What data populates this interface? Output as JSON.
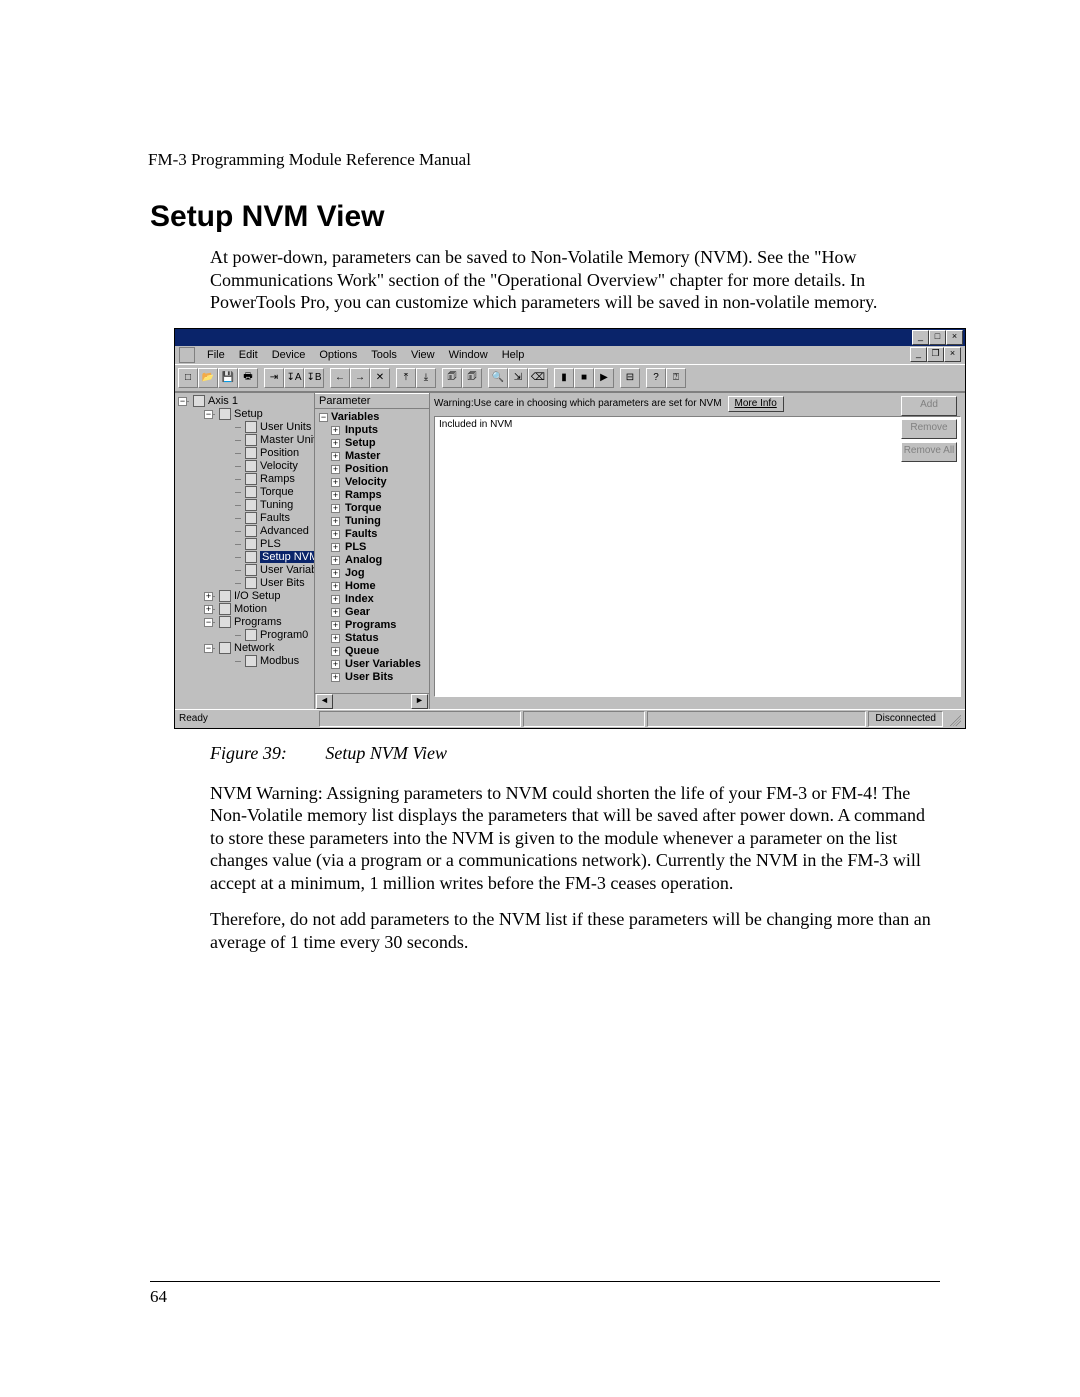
{
  "doc": {
    "header": "FM-3 Programming Module Reference Manual",
    "title": "Setup NVM View",
    "intro": "At power-down, parameters can be saved to Non-Volatile Memory (NVM). See the \"How Communications Work\" section of the \"Operational Overview\" chapter for more details. In PowerTools Pro, you can customize which parameters will be saved in non-volatile memory.",
    "figure_label": "Figure 39:",
    "figure_title": "Setup NVM View",
    "para2": "NVM Warning: Assigning parameters to NVM could shorten the life of your FM-3 or FM-4! The Non-Volatile memory list displays the parameters that will be saved after power down. A command to store these parameters into the NVM is given to the module whenever a parameter on the list changes value (via a program or a communications network). Currently the NVM in the FM-3 will accept at a minimum, 1 million writes before the FM-3 ceases operation.",
    "para3": "Therefore, do not add parameters to the NVM list if these parameters will be changing more than an average of 1 time every 30 seconds.",
    "page_number": "64"
  },
  "win": {
    "title_controls": {
      "min": "_",
      "max": "□",
      "close": "×"
    },
    "mdi_controls": {
      "min": "_",
      "restore": "❐",
      "close": "×"
    },
    "menus": [
      "File",
      "Edit",
      "Device",
      "Options",
      "Tools",
      "View",
      "Window",
      "Help"
    ],
    "toolbar_icons": [
      "□",
      "📂",
      "💾",
      "🖶",
      "",
      "⇥",
      "↧A",
      "↧B",
      "",
      "←",
      "→",
      "✕",
      "",
      "⤒",
      "⤓",
      "",
      "🗊",
      "🗊",
      "",
      "🔍",
      "⇲",
      "⌫",
      "",
      "▮",
      "■",
      "▶",
      "",
      "⊟",
      "",
      "?",
      "⍰"
    ],
    "tree": {
      "root": "Axis 1",
      "setup": "Setup",
      "setup_children": [
        "User Units",
        "Master Units",
        "Position",
        "Velocity",
        "Ramps",
        "Torque",
        "Tuning",
        "Faults",
        "Advanced",
        "PLS"
      ],
      "setup_nvm": "Setup NVM",
      "post_setup": [
        "User Variables",
        "User Bits"
      ],
      "siblings": [
        "I/O Setup",
        "Motion"
      ],
      "programs": "Programs",
      "program0": "Program0",
      "network": "Network",
      "modbus": "Modbus"
    },
    "params": {
      "header": "Parameter",
      "root": "Variables",
      "children": [
        "Inputs",
        "Setup",
        "Master",
        "Position",
        "Velocity",
        "Ramps",
        "Torque",
        "Tuning",
        "Faults",
        "PLS",
        "Analog",
        "Jog",
        "Home",
        "Index",
        "Gear",
        "Programs",
        "Status",
        "Queue",
        "User Variables",
        "User Bits"
      ]
    },
    "right": {
      "warning": "Warning:Use care in choosing which parameters are set for NVM",
      "more_info": "More Info",
      "included_label": "Included in NVM",
      "buttons": {
        "add": "Add",
        "remove": "Remove",
        "remove_all": "Remove All"
      }
    },
    "status": {
      "left": "Ready",
      "right": "Disconnected"
    }
  }
}
